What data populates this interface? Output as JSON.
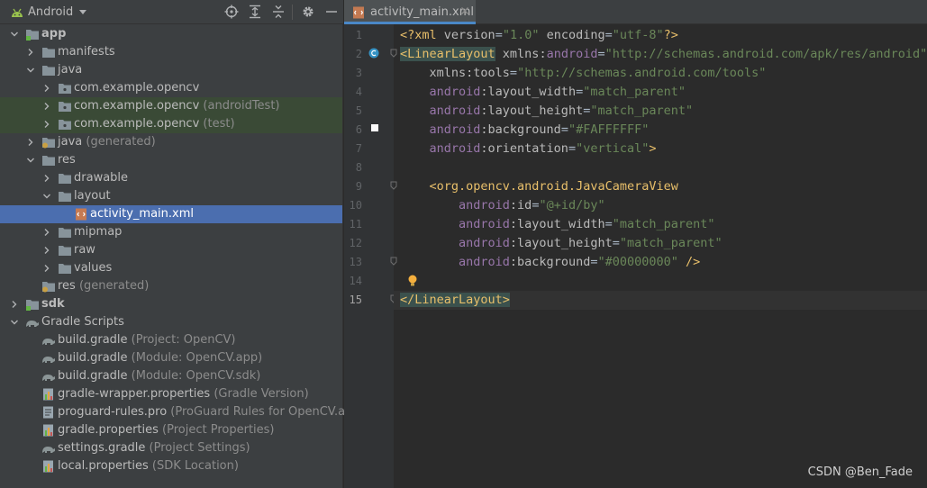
{
  "project_panel": {
    "view_label": "Android",
    "tree": [
      {
        "label": "app",
        "suffix": "",
        "depth": 0,
        "expanded": true,
        "icon": "module-folder-icon",
        "bold": true
      },
      {
        "label": "manifests",
        "suffix": "",
        "depth": 1,
        "expanded": false,
        "icon": "folder-icon"
      },
      {
        "label": "java",
        "suffix": "",
        "depth": 1,
        "expanded": true,
        "icon": "folder-icon"
      },
      {
        "label": "com.example.opencv",
        "suffix": "",
        "depth": 2,
        "expanded": false,
        "icon": "package-icon"
      },
      {
        "label": "com.example.opencv",
        "suffix": " (androidTest)",
        "depth": 2,
        "expanded": false,
        "icon": "package-icon",
        "test": true
      },
      {
        "label": "com.example.opencv",
        "suffix": " (test)",
        "depth": 2,
        "expanded": false,
        "icon": "package-icon",
        "test": true
      },
      {
        "label": "java",
        "suffix": " (generated)",
        "depth": 1,
        "expanded": false,
        "icon": "generated-folder-icon"
      },
      {
        "label": "res",
        "suffix": "",
        "depth": 1,
        "expanded": true,
        "icon": "folder-icon"
      },
      {
        "label": "drawable",
        "suffix": "",
        "depth": 2,
        "expanded": false,
        "icon": "folder-icon"
      },
      {
        "label": "layout",
        "suffix": "",
        "depth": 2,
        "expanded": true,
        "icon": "folder-icon"
      },
      {
        "label": "activity_main.xml",
        "suffix": "",
        "depth": 3,
        "leaf": true,
        "icon": "xml-file-icon",
        "selected": true
      },
      {
        "label": "mipmap",
        "suffix": "",
        "depth": 2,
        "expanded": false,
        "icon": "folder-icon"
      },
      {
        "label": "raw",
        "suffix": "",
        "depth": 2,
        "expanded": false,
        "icon": "folder-icon"
      },
      {
        "label": "values",
        "suffix": "",
        "depth": 2,
        "expanded": false,
        "icon": "folder-icon"
      },
      {
        "label": "res",
        "suffix": " (generated)",
        "depth": 1,
        "leaf": true,
        "icon": "generated-folder-icon"
      },
      {
        "label": "sdk",
        "suffix": "",
        "depth": 0,
        "expanded": false,
        "icon": "module-folder-icon",
        "bold": true
      },
      {
        "label": "Gradle Scripts",
        "suffix": "",
        "depth": 0,
        "expanded": true,
        "icon": "gradle-icon"
      },
      {
        "label": "build.gradle",
        "suffix": " (Project: OpenCV)",
        "depth": 1,
        "leaf": true,
        "icon": "gradle-icon"
      },
      {
        "label": "build.gradle",
        "suffix": " (Module: OpenCV.app)",
        "depth": 1,
        "leaf": true,
        "icon": "gradle-icon"
      },
      {
        "label": "build.gradle",
        "suffix": " (Module: OpenCV.sdk)",
        "depth": 1,
        "leaf": true,
        "icon": "gradle-icon"
      },
      {
        "label": "gradle-wrapper.properties",
        "suffix": " (Gradle Version)",
        "depth": 1,
        "leaf": true,
        "icon": "properties-file-icon"
      },
      {
        "label": "proguard-rules.pro",
        "suffix": " (ProGuard Rules for OpenCV.app)",
        "depth": 1,
        "leaf": true,
        "icon": "text-file-icon"
      },
      {
        "label": "gradle.properties",
        "suffix": " (Project Properties)",
        "depth": 1,
        "leaf": true,
        "icon": "properties-file-icon"
      },
      {
        "label": "settings.gradle",
        "suffix": " (Project Settings)",
        "depth": 1,
        "leaf": true,
        "icon": "gradle-icon"
      },
      {
        "label": "local.properties",
        "suffix": " (SDK Location)",
        "depth": 1,
        "leaf": true,
        "icon": "properties-file-icon"
      }
    ]
  },
  "editor": {
    "tab_title": "activity_main.xml",
    "current_line": 15,
    "lines": [
      {
        "n": "1",
        "tokens": [
          [
            "t-tag",
            "<?xml "
          ],
          [
            "t-attr",
            "version"
          ],
          [
            "t-plain",
            "="
          ],
          [
            "t-val",
            "\"1.0\""
          ],
          [
            "t-attr",
            " encoding"
          ],
          [
            "t-plain",
            "="
          ],
          [
            "t-val",
            "\"utf-8\""
          ],
          [
            "t-tag",
            "?>"
          ]
        ]
      },
      {
        "n": "2",
        "tokens": [
          [
            "t-tag t-match",
            "<LinearLayout"
          ],
          [
            "t-attr",
            " xmlns:"
          ],
          [
            "t-ns",
            "android"
          ],
          [
            "t-plain",
            "="
          ],
          [
            "t-val",
            "\"http://schemas.android.com/apk/res/android\""
          ]
        ]
      },
      {
        "n": "3",
        "tokens": [
          [
            "t-attr",
            "    xmlns:tools"
          ],
          [
            "t-plain",
            "="
          ],
          [
            "t-val",
            "\"http://schemas.android.com/tools\""
          ]
        ]
      },
      {
        "n": "4",
        "tokens": [
          [
            "t-ns",
            "    android"
          ],
          [
            "t-attr",
            ":layout_width"
          ],
          [
            "t-plain",
            "="
          ],
          [
            "t-val",
            "\"match_parent\""
          ]
        ]
      },
      {
        "n": "5",
        "tokens": [
          [
            "t-ns",
            "    android"
          ],
          [
            "t-attr",
            ":layout_height"
          ],
          [
            "t-plain",
            "="
          ],
          [
            "t-val",
            "\"match_parent\""
          ]
        ]
      },
      {
        "n": "6",
        "tokens": [
          [
            "t-ns",
            "    android"
          ],
          [
            "t-attr",
            ":background"
          ],
          [
            "t-plain",
            "="
          ],
          [
            "t-val",
            "\"#FAFFFFFF\""
          ]
        ]
      },
      {
        "n": "7",
        "tokens": [
          [
            "t-ns",
            "    android"
          ],
          [
            "t-attr",
            ":orientation"
          ],
          [
            "t-plain",
            "="
          ],
          [
            "t-val",
            "\"vertical\""
          ],
          [
            "t-tag",
            ">"
          ]
        ]
      },
      {
        "n": "8",
        "tokens": []
      },
      {
        "n": "9",
        "tokens": [
          [
            "t-tag",
            "    <org.opencv.android.JavaCameraView"
          ]
        ]
      },
      {
        "n": "10",
        "tokens": [
          [
            "t-ns",
            "        android"
          ],
          [
            "t-attr",
            ":id"
          ],
          [
            "t-plain",
            "="
          ],
          [
            "t-val",
            "\"@+id/by\""
          ]
        ]
      },
      {
        "n": "11",
        "tokens": [
          [
            "t-ns",
            "        android"
          ],
          [
            "t-attr",
            ":layout_width"
          ],
          [
            "t-plain",
            "="
          ],
          [
            "t-val",
            "\"match_parent\""
          ]
        ]
      },
      {
        "n": "12",
        "tokens": [
          [
            "t-ns",
            "        android"
          ],
          [
            "t-attr",
            ":layout_height"
          ],
          [
            "t-plain",
            "="
          ],
          [
            "t-val",
            "\"match_parent\""
          ]
        ]
      },
      {
        "n": "13",
        "tokens": [
          [
            "t-ns",
            "        android"
          ],
          [
            "t-attr",
            ":background"
          ],
          [
            "t-plain",
            "="
          ],
          [
            "t-val",
            "\"#00000000\""
          ],
          [
            "t-tag",
            " />"
          ]
        ]
      },
      {
        "n": "14",
        "tokens": []
      },
      {
        "n": "15",
        "tokens": [
          [
            "t-tag t-match",
            "</LinearLayout>"
          ]
        ]
      }
    ]
  },
  "watermark": "CSDN @Ben_Fade",
  "colors": {
    "selection": "#4b6eaf",
    "test_bg": "#3a4a36",
    "panel": "#3c3f41",
    "editor": "#2b2b2b"
  }
}
